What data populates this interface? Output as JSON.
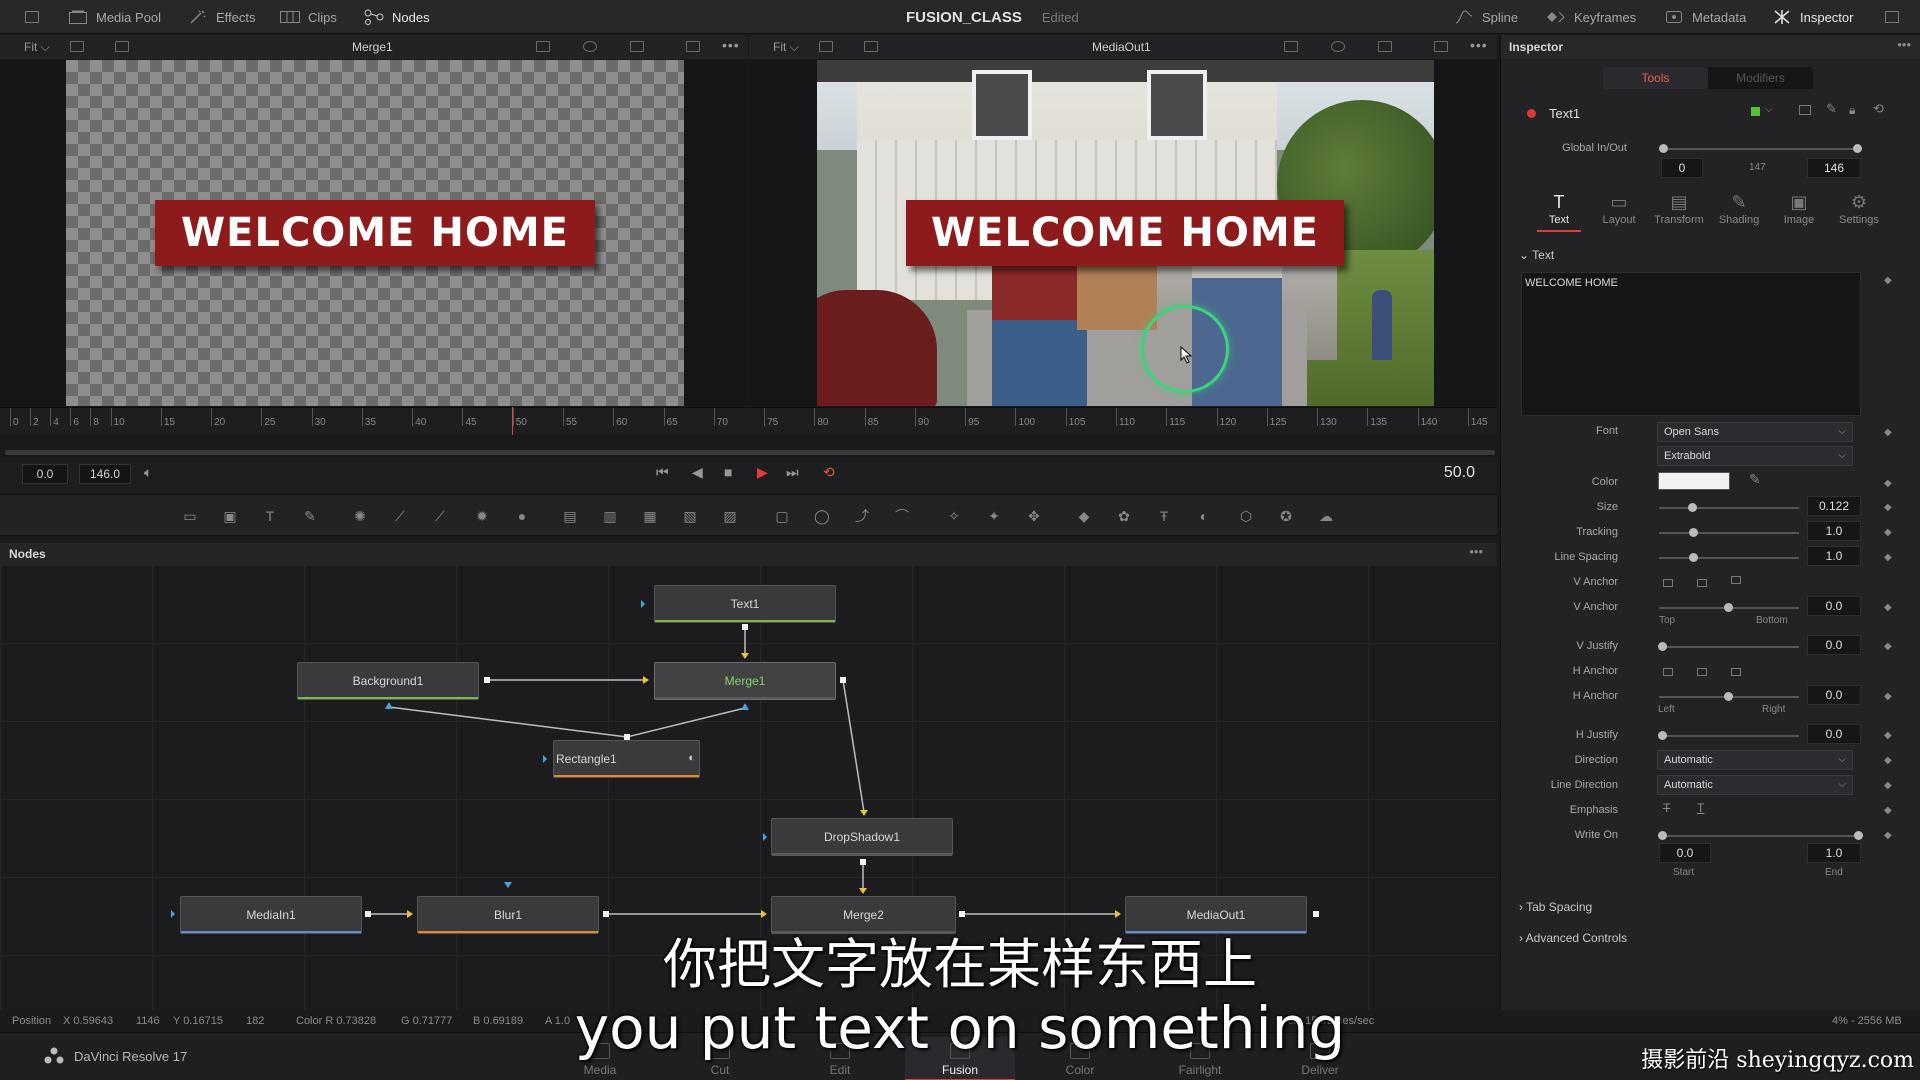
{
  "topbar": {
    "left_items": [
      {
        "label": "Media Pool",
        "icon": "media-pool-icon"
      },
      {
        "label": "Effects",
        "icon": "effects-icon"
      },
      {
        "label": "Clips",
        "icon": "clips-icon"
      },
      {
        "label": "Nodes",
        "icon": "nodes-icon"
      }
    ],
    "project_title": "FUSION_CLASS",
    "project_status": "Edited",
    "right_items": [
      {
        "label": "Spline",
        "icon": "spline-icon"
      },
      {
        "label": "Keyframes",
        "icon": "keyframes-icon"
      },
      {
        "label": "Metadata",
        "icon": "metadata-icon"
      },
      {
        "label": "Inspector",
        "icon": "inspector-icon"
      }
    ]
  },
  "viewers": {
    "left": {
      "fit": "Fit",
      "name": "Merge1",
      "banner_text": "WELCOME HOME"
    },
    "right": {
      "fit": "Fit",
      "name": "MediaOut1",
      "banner_text": "WELCOME HOME"
    }
  },
  "ruler": {
    "labels": [
      "0",
      "2",
      "4",
      "6",
      "8",
      "10",
      "15",
      "20",
      "25",
      "30",
      "35",
      "40",
      "45",
      "50",
      "55",
      "60",
      "65",
      "70",
      "75",
      "80",
      "85",
      "90",
      "95",
      "100",
      "105",
      "110",
      "115",
      "120",
      "125",
      "130",
      "135",
      "140",
      "145"
    ]
  },
  "transport": {
    "start_frame": "0.0",
    "end_frame": "146.0",
    "current_frame": "50.0"
  },
  "nodes_panel": {
    "title": "Nodes",
    "nodes": {
      "text1": "Text1",
      "background1": "Background1",
      "merge1": "Merge1",
      "rectangle1": "Rectangle1",
      "dropshadow1": "DropShadow1",
      "mediain1": "MediaIn1",
      "blur1": "Blur1",
      "merge2": "Merge2",
      "mediaout1": "MediaOut1"
    }
  },
  "statusbar": {
    "position": "Position",
    "x": "X 0.59643",
    "x_px": "1146",
    "y": "Y 0.16715",
    "y_px": "182",
    "color_r": "Color R 0.73828",
    "color_g": "G 0.71777",
    "color_b": "B 0.69189",
    "alpha": "A 1.0",
    "fps": "ck: 15 frames/sec",
    "memory": "4% - 2556 MB"
  },
  "pagebar": {
    "app_name": "DaVinci Resolve 17",
    "tabs": [
      "Media",
      "Cut",
      "Edit",
      "Fusion",
      "Color",
      "Fairlight",
      "Deliver"
    ],
    "active_tab": "Fusion"
  },
  "subtitles": {
    "chinese": "你把文字放在某样东西上",
    "english": "you put text on something",
    "watermark": "摄影前沿 sheyingqyz.com"
  },
  "inspector": {
    "title": "Inspector",
    "tabs": {
      "tools": "Tools",
      "modifiers": "Modifiers"
    },
    "tool_name": "Text1",
    "global_inout_label": "Global In/Out",
    "global_in": "0",
    "global_mid": "147",
    "global_out": "146",
    "subtabs": [
      {
        "label": "Text",
        "glyph": "T"
      },
      {
        "label": "Layout",
        "glyph": "▭"
      },
      {
        "label": "Transform",
        "glyph": "▤"
      },
      {
        "label": "Shading",
        "glyph": "✎"
      },
      {
        "label": "Image",
        "glyph": "▣"
      },
      {
        "label": "Settings",
        "glyph": "⚙"
      }
    ],
    "text_section": "Text",
    "styled_text": "WELCOME HOME",
    "font_label": "Font",
    "font_value": "Open Sans",
    "font_style": "Extrabold",
    "color_label": "Color",
    "color_swatch": "#f2f2f2",
    "size_label": "Size",
    "size_value": "0.122",
    "tracking_label": "Tracking",
    "tracking_value": "1.0",
    "line_spacing_label": "Line Spacing",
    "line_spacing_value": "1.0",
    "v_anchor_label": "V Anchor",
    "v_anchor_value": "0.0",
    "v_anchor_top": "Top",
    "v_anchor_bottom": "Bottom",
    "v_justify_label": "V Justify",
    "v_justify_value": "0.0",
    "h_anchor_label": "H Anchor",
    "h_anchor_value": "0.0",
    "h_anchor_left": "Left",
    "h_anchor_right": "Right",
    "h_justify_label": "H Justify",
    "h_justify_value": "0.0",
    "direction_label": "Direction",
    "direction_value": "Automatic",
    "line_direction_label": "Line Direction",
    "line_direction_value": "Automatic",
    "emphasis_label": "Emphasis",
    "write_on_label": "Write On",
    "write_on_start": "0.0",
    "write_on_end": "1.0",
    "write_on_start_label": "Start",
    "write_on_end_label": "End",
    "tab_spacing": "Tab Spacing",
    "advanced_controls": "Advanced Controls"
  }
}
